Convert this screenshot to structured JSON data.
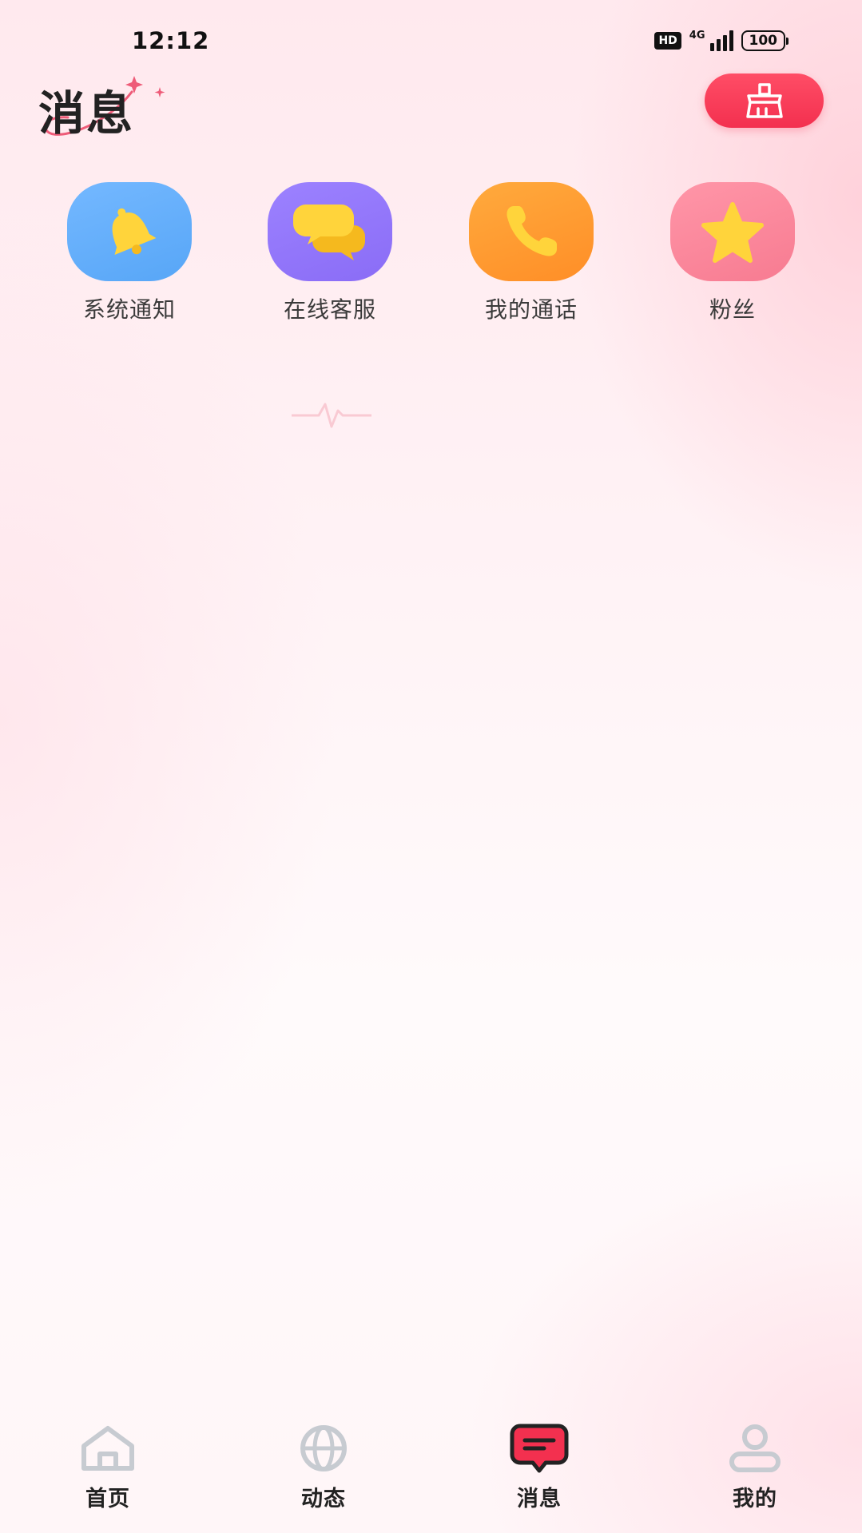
{
  "status_bar": {
    "time": "12:12",
    "hd": "HD",
    "network": "4G",
    "battery": "100"
  },
  "header": {
    "title": "消息"
  },
  "quick_entries": [
    {
      "label": "系统通知",
      "icon": "bell-icon",
      "color": "#5aa8f8"
    },
    {
      "label": "在线客服",
      "icon": "chat-bubbles-icon",
      "color": "#8d70f7"
    },
    {
      "label": "我的通话",
      "icon": "phone-icon",
      "color": "#ff922b"
    },
    {
      "label": "粉丝",
      "icon": "star-icon",
      "color": "#f87f95"
    }
  ],
  "bottom_nav": {
    "items": [
      {
        "label": "首页",
        "icon": "home-icon",
        "active": false
      },
      {
        "label": "动态",
        "icon": "globe-icon",
        "active": false
      },
      {
        "label": "消息",
        "icon": "message-icon",
        "active": true
      },
      {
        "label": "我的",
        "icon": "user-icon",
        "active": false
      }
    ]
  },
  "colors": {
    "accent": "#f3304f",
    "icon_yellow": "#ffd43b",
    "nav_inactive": "#c7cbd1"
  }
}
